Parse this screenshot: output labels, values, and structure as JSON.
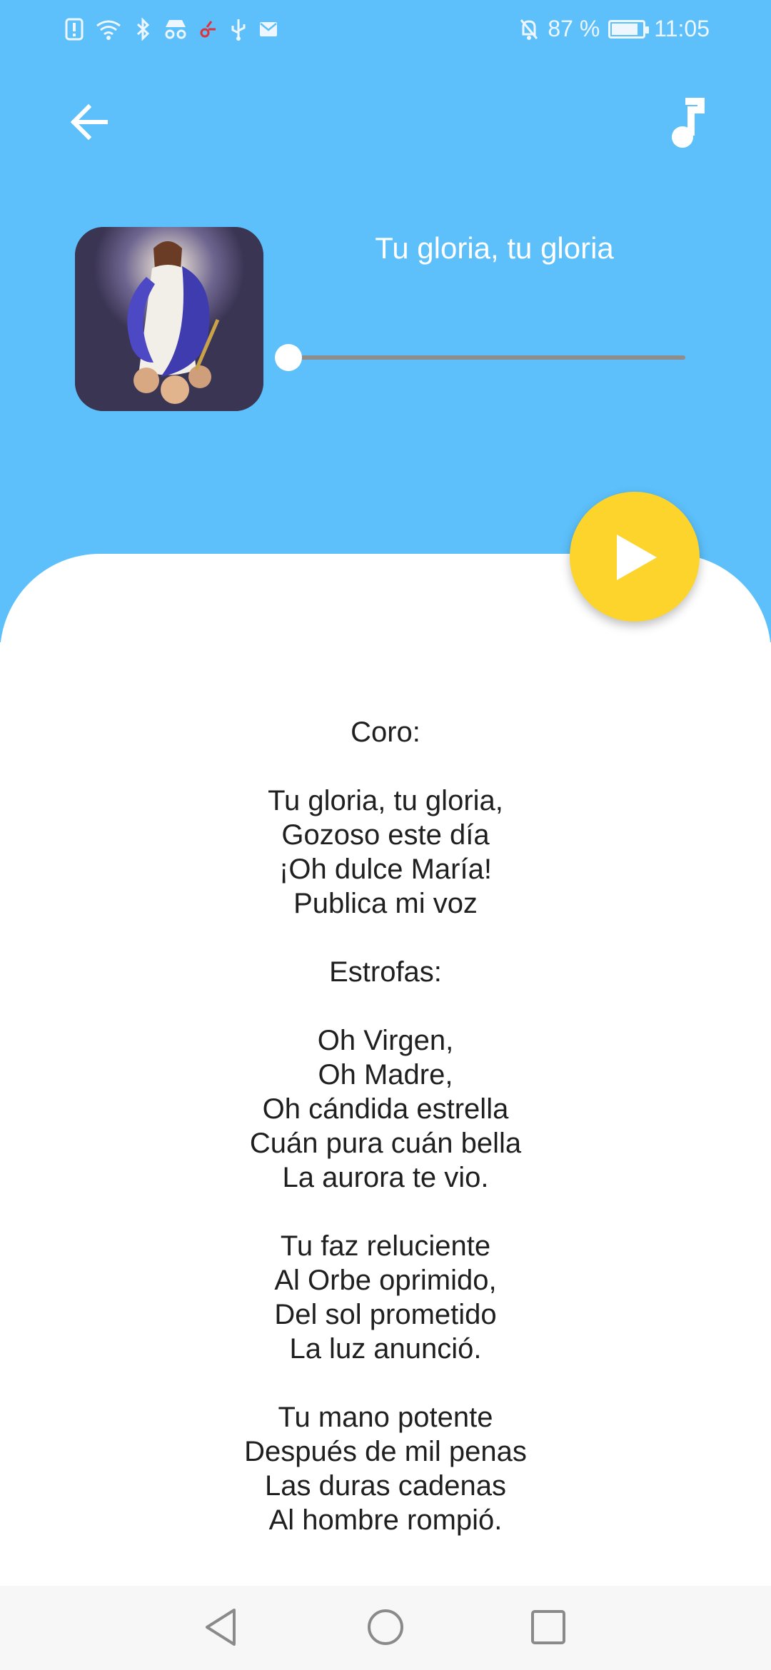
{
  "status_bar": {
    "battery_percent": "87 %",
    "time": "11:05",
    "icons": [
      "alert-icon",
      "wifi-icon",
      "bluetooth-icon",
      "incognito-icon",
      "cast-icon",
      "usb-icon",
      "mail-icon",
      "bell-off-icon",
      "battery-icon"
    ]
  },
  "toolbar": {
    "back_icon": "arrow-left-icon",
    "music_icon": "music-note-icon"
  },
  "player": {
    "title": "Tu gloria, tu gloria",
    "progress": 0.0,
    "play_icon": "play-icon",
    "accent": "#fdd42b",
    "header_color": "#5dc0fa"
  },
  "lyrics": {
    "stanzas": [
      [
        "Coro:"
      ],
      [
        "Tu gloria, tu gloria,",
        "Gozoso este día",
        "¡Oh dulce María!",
        "Publica mi voz"
      ],
      [
        "Estrofas:"
      ],
      [
        "Oh Virgen,",
        "Oh Madre,",
        "Oh cándida estrella",
        "Cuán pura cuán bella",
        "La aurora te vio."
      ],
      [
        "Tu faz reluciente",
        "Al Orbe oprimido,",
        "Del sol prometido",
        "La luz anunció."
      ],
      [
        "Tu mano potente",
        "Después de mil penas",
        "Las duras cadenas",
        "Al hombre rompió."
      ]
    ]
  },
  "nav_bar": {
    "icons": [
      "nav-back-icon",
      "nav-home-icon",
      "nav-recent-icon"
    ]
  }
}
